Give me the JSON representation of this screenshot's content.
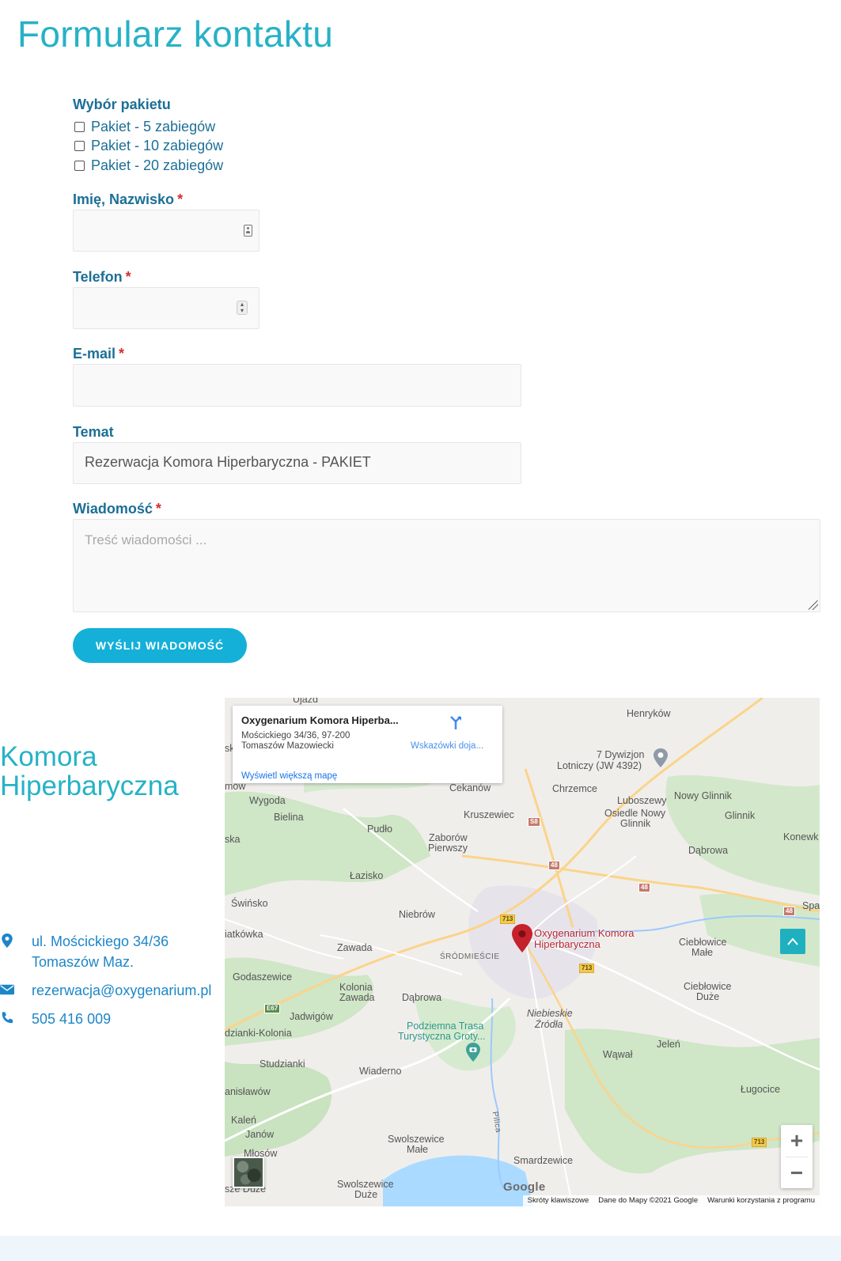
{
  "page": {
    "title": "Formularz kontaktu"
  },
  "form": {
    "package_label": "Wybór pakietu",
    "packages": [
      "Pakiet - 5 zabiegów",
      "Pakiet - 10 zabiegów",
      "Pakiet - 20 zabiegów"
    ],
    "name_label": "Imię, Nazwisko",
    "phone_label": "Telefon",
    "email_label": "E-mail",
    "subject_label": "Temat",
    "subject_value": "Rezerwacja Komora Hiperbaryczna - PAKIET",
    "message_label": "Wiadomość",
    "message_placeholder": "Treść wiadomości ...",
    "required_mark": "*",
    "submit_label": "WYŚLIJ WIADOMOŚĆ"
  },
  "contact": {
    "title_line1": "Komora",
    "title_line2": "Hiperbaryczna",
    "address_line1": "ul. Mościckiego 34/36",
    "address_line2": "Tomaszów Maz.",
    "email": "rezerwacja@oxygenarium.pl",
    "phone": "505 416 009"
  },
  "map": {
    "info_window": {
      "title": "Oxygenarium Komora Hiperba...",
      "address_line1": "Mościckiego 34/36, 97-200",
      "address_line2": "Tomaszów Mazowiecki",
      "directions": "Wskazówki doja...",
      "larger_map": "Wyświetl większą mapę"
    },
    "pin_label_line1": "Oxygenarium Komora",
    "pin_label_line2": "Hiperbaryczna",
    "places": {
      "ujazd": "Ujazd",
      "henrykow": "Henryków",
      "dywizjon1": "7 Dywizjon",
      "dywizjon2": "Lotniczy (JW 4392)",
      "sk": "sk",
      "mow": "mów",
      "cekanow": "Cekanów",
      "chrzemce": "Chrzemce",
      "luboszewy": "Luboszewy",
      "nowy_glinnik": "Nowy Glinnik",
      "osiedle1": "Osiedle Nowy",
      "osiedle2": "Glinnik",
      "glinnik": "Glinnik",
      "konewk": "Konewk",
      "wygoda": "Wygoda",
      "bielina": "Bielina",
      "kruszewiec": "Kruszewiec",
      "pudlo": "Pudło",
      "zaborow1": "Zaborów",
      "zaborow2": "Pierwszy",
      "ska": "ska",
      "dabrowa_e": "Dąbrowa",
      "lazisko": "Łazisko",
      "swinsko": "Świńsko",
      "niebrow": "Niebrów",
      "spa": "Spa",
      "iatkowka": "iatkówka",
      "zawada": "Zawada",
      "srodmiescie": "ŚRÓDMIEŚCIE",
      "cieblowice_m1": "Ciebłowice",
      "cieblowice_m2": "Małe",
      "godaszewice": "Godaszewice",
      "kolonia1": "Kolonia",
      "kolonia2": "Zawada",
      "dabrowa_s": "Dąbrowa",
      "cieblowice_d1": "Ciebłowice",
      "cieblowice_d2": "Duże",
      "jadwigow": "Jadwigów",
      "dzianki": "dzianki-Kolonia",
      "niebieskie1": "Niebieskie",
      "niebieskie2": "Źródła",
      "podziemna1": "Podziemna Trasa",
      "podziemna2": "Turystyczna Groty...",
      "studzianki": "Studzianki",
      "wawal": "Wąwał",
      "jelen": "Jeleń",
      "wiaderno": "Wiaderno",
      "anislawow": "anisławów",
      "slugocice": "Ługocice",
      "kalen": "Kaleń",
      "janow": "Janów",
      "pilica": "Pilica",
      "swolszewice_m1": "Swolszewice",
      "swolszewice_m2": "Małe",
      "mlosow": "Młosów",
      "smardzewice": "Smardzewice",
      "swolszewice_d1": "Swolszewice",
      "swolszewice_d2": "Duże",
      "sze_duze": "sze Duże"
    },
    "road_shields": {
      "s8": "S8",
      "r48a": "48",
      "r48b": "48",
      "r48c": "48",
      "r713a": "713",
      "r713b": "713",
      "r713c": "713",
      "e67": "E67"
    },
    "zoom_in": "+",
    "zoom_out": "−",
    "google_logo": "Google",
    "footer": {
      "shortcuts": "Skróty klawiszowe",
      "data": "Dane do Mapy ©2021 Google",
      "terms": "Warunki korzystania z programu"
    }
  },
  "colors": {
    "accent_title": "#26b2c6",
    "label_blue": "#1c6f96",
    "link_blue": "#1d86c8",
    "button": "#14b0d8",
    "required": "#d0312d"
  }
}
